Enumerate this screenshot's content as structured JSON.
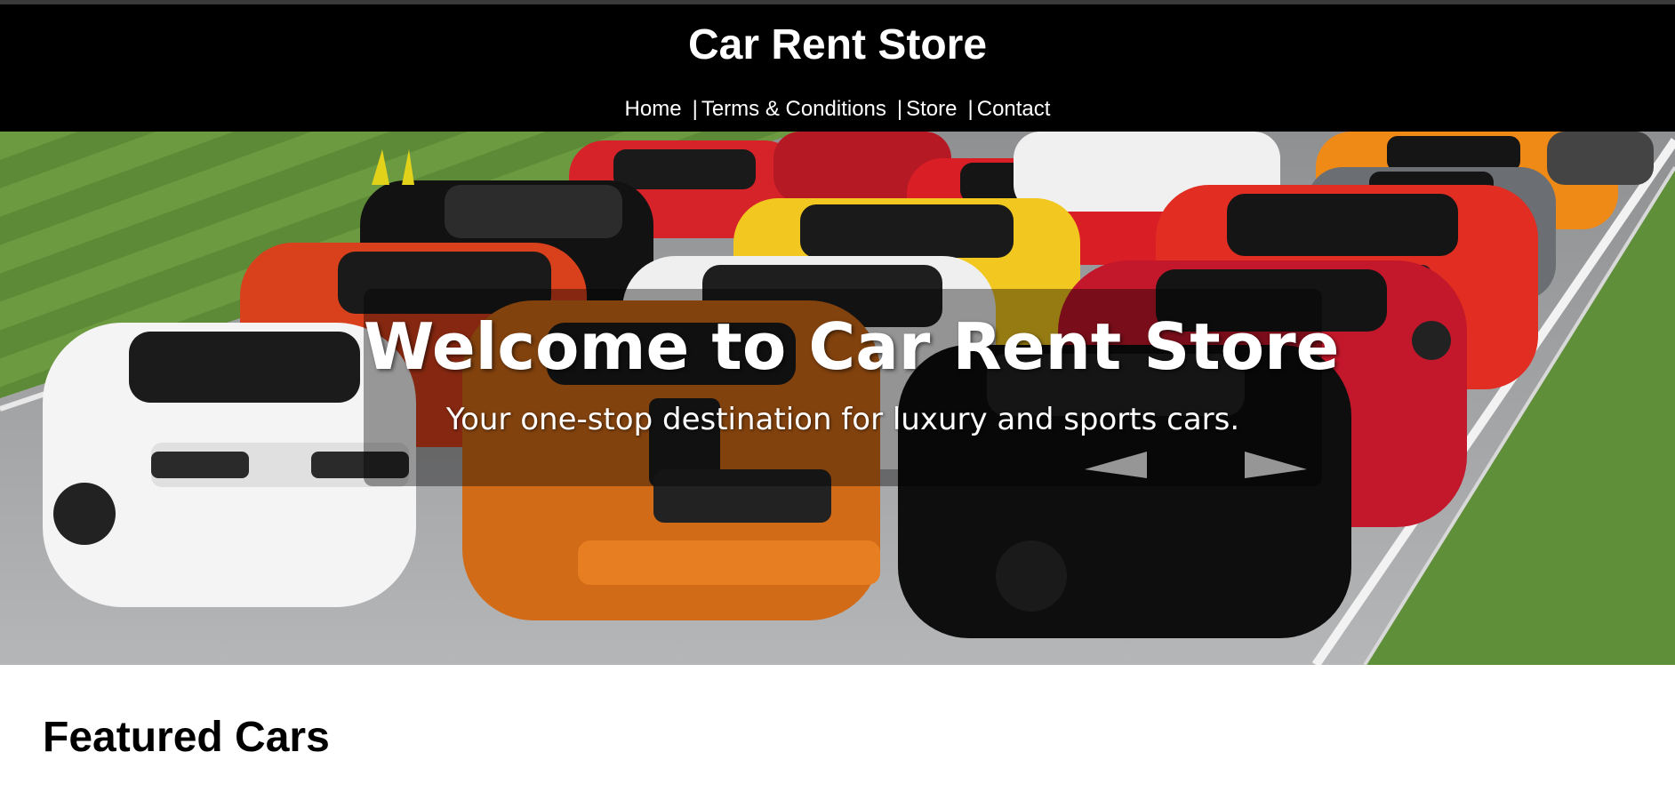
{
  "header": {
    "site_title": "Car Rent Store",
    "nav": [
      {
        "label": "Home"
      },
      {
        "label": "Terms & Conditions"
      },
      {
        "label": "Store"
      },
      {
        "label": "Contact"
      }
    ],
    "nav_separator": "|"
  },
  "hero": {
    "title": "Welcome to Car Rent Store",
    "subtitle": "Your one-stop destination for luxury and sports cars.",
    "image_name": "sports-cars-lineup-photo"
  },
  "featured": {
    "heading": "Featured Cars"
  },
  "colors": {
    "header_bg": "#000000",
    "header_text": "#ffffff",
    "page_bg": "#ffffff"
  }
}
